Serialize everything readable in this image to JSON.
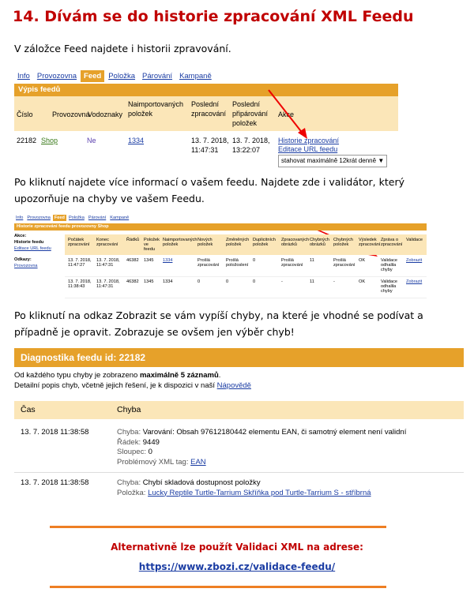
{
  "heading": "14.  Dívám se do historie zpracování XML Feedu",
  "intro1": "V záložce Feed najdete i historii zpravování.",
  "shot1": {
    "tabs": [
      "Info",
      "Provozovna",
      "Feed",
      "Položka",
      "Párování",
      "Kampaně"
    ],
    "bar": "Výpis feedů",
    "cols": [
      "Číslo",
      "Provozovna",
      "Vodoznaky",
      "Naimportovaných položek",
      "Poslední zpracování",
      "Poslední připárování položek",
      "Akce"
    ],
    "row": {
      "id": "22182",
      "shop": "Shop",
      "watermark": "Ne",
      "count": "1334",
      "processed": "13. 7. 2018, 11:47:31",
      "paired": "13. 7. 2018, 13:22:07",
      "link_history": "Historie zpracování",
      "link_edit": "Editace URL feedu",
      "select_value": "stahovat maximálně 12krát denně"
    }
  },
  "intro2": "Po kliknutí najdete více informací o vašem feedu. Najdete zde i validátor, který upozorňuje na chyby ve vašem Feedu.",
  "shot2": {
    "tabs": [
      "Info",
      "Provozovna",
      "Feed",
      "Položka",
      "Párování",
      "Kampaně"
    ],
    "bar": "Historie zpracování feedu provozovny Shop",
    "side_akce": "Akce:",
    "side_hist": "Historie feedu",
    "side_edit": "Editace URL feedu",
    "side_odkazy": "Odkazy:",
    "side_prov": "Provozovna",
    "cols": [
      "Počátek zpracování",
      "Konec zpracování",
      "Řádků",
      "Položek ve feedu",
      "Naimportovaných položek",
      "Nových položek",
      "Změněných položek",
      "Duplicitních položek",
      "Zpracovaných obrázků",
      "Chybných obrázků",
      "Chybných položek",
      "Výsledek zpracování",
      "Zpráva o zpracování",
      "Validace"
    ],
    "rows": [
      [
        "13. 7. 2018, 11:47:27",
        "13. 7. 2018, 11:47:31",
        "46382",
        "1345",
        "1334",
        "Prošlá zpracování",
        "Prošlá položoslení",
        "0",
        "Prošlá zpracování",
        "11",
        "Prošlá zpracování",
        "OK",
        "Validace odhalila chyby",
        "Zobrazit"
      ],
      [
        "13. 7. 2018, 11:38:43",
        "13. 7. 2018, 11:47:31",
        "46382",
        "1345",
        "1334",
        "0",
        "0",
        "0",
        "-",
        "11",
        "-",
        "OK",
        "Validace odhalila chyby",
        "Zobrazit"
      ]
    ]
  },
  "intro3": "Po kliknutí na odkaz Zobrazit se vám vypíší chyby, na které je vhodné se podívat a případně je opravit. Zobrazuje se ovšem jen výběr chyb!",
  "diag": {
    "title": "Diagnostika feedu id: 22182",
    "note_pre": "Od každého typu chyby je zobrazeno ",
    "note_bold": "maximálně 5 záznamů",
    "note_post": ".",
    "note2_pre": "Detailní popis chyb, včetně jejich řešení, je k dispozici v naší ",
    "note2_link": "Nápovědě",
    "col_time": "Čas",
    "col_error": "Chyba",
    "rows": [
      {
        "time": "13. 7. 2018 11:38:58",
        "l1_label": "Chyba:",
        "l1_val": "Varování: Obsah 97612180442 elementu EAN, či samotný element není validní",
        "l2_label": "Řádek:",
        "l2_val": "9449",
        "l3_label": "Sloupec:",
        "l3_val": "0",
        "l4_label": "Problémový XML tag:",
        "l4_val": "EAN"
      },
      {
        "time": "13. 7. 2018 11:38:58",
        "l1_label": "Chyba:",
        "l1_val": "Chybí skladová dostupnost položky",
        "l2_label": "Položka:",
        "l2_val": "Lucky Reptile Turtle-Tarrium Skříňka pod Turtle-Tarrium S - stříbrná"
      }
    ]
  },
  "alt_text": "Alternativně lze použít Validaci XML na adrese:",
  "alt_url": "https://www.zbozi.cz/validace-feedu/"
}
